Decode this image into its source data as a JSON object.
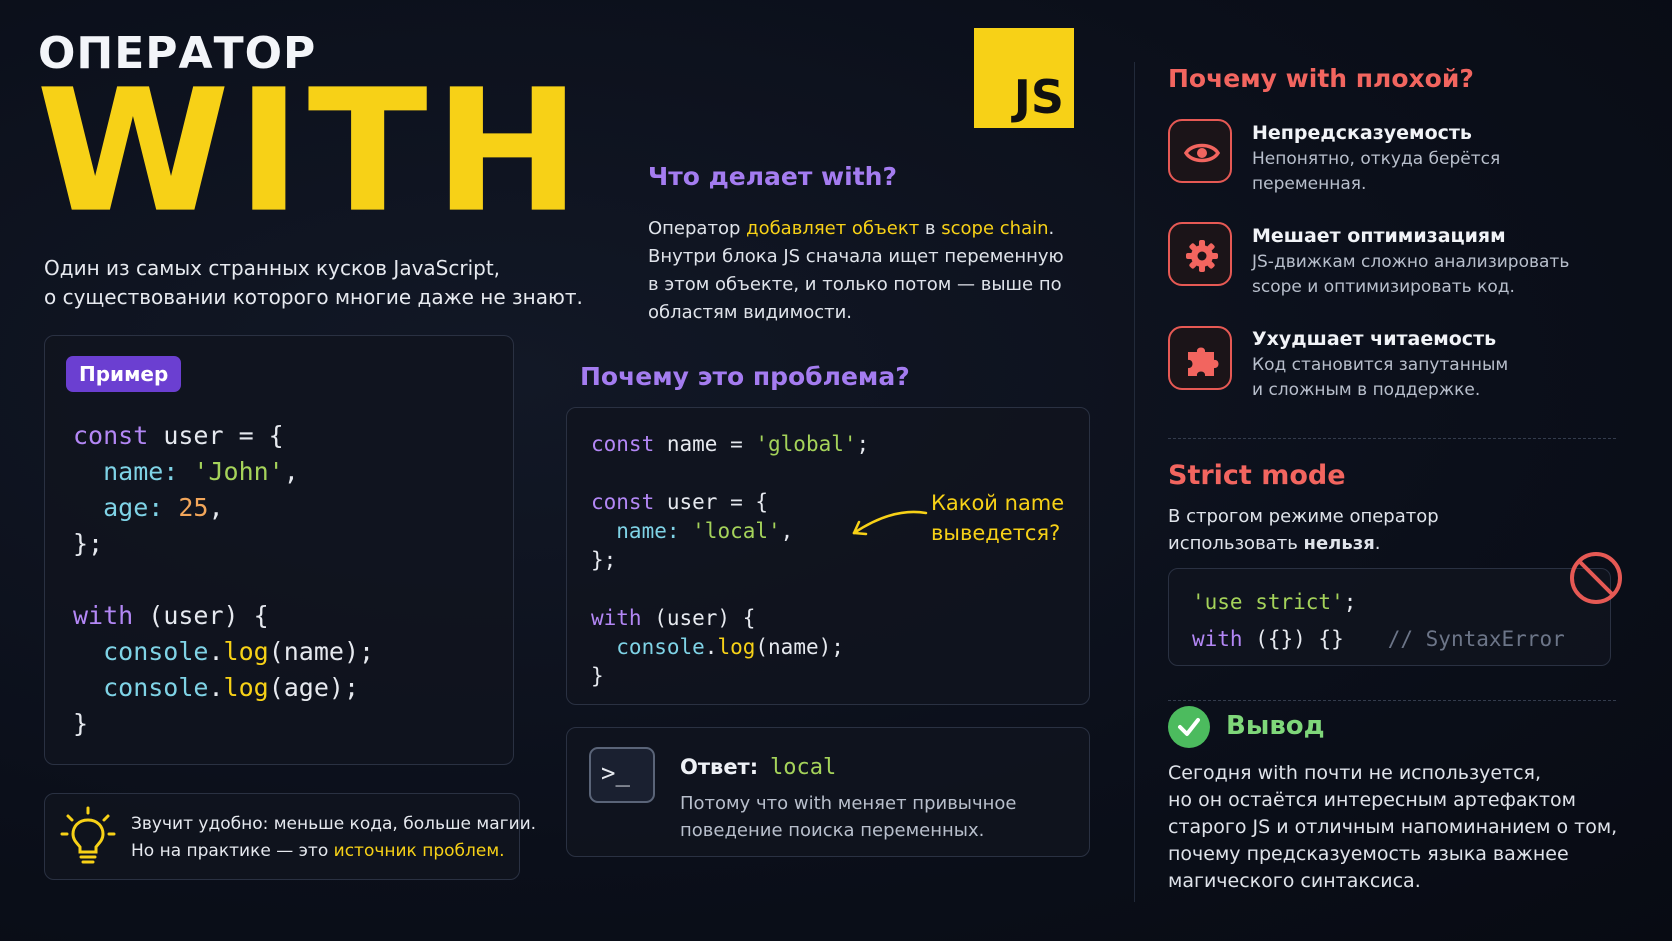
{
  "header": {
    "kicker": "ОПЕРАТОР",
    "title": "WITH",
    "subtitle_line1": "Один из самых странных кусков JavaScript,",
    "subtitle_line2": "о существовании которого многие даже не знают."
  },
  "logo": {
    "text": "JS",
    "color": "#f7d117"
  },
  "example": {
    "badge": "Пример",
    "code": {
      "l1_kw": "const",
      "l1_rest": " user = {",
      "l2_prop": "  name:",
      "l2_str": " 'John'",
      "l2_end": ",",
      "l3_prop": "  age:",
      "l3_num": " 25",
      "l3_end": ",",
      "l4": "};",
      "l5": "",
      "l6_kw": "with",
      "l6_rest": " (user) {",
      "l7_obj": "  console",
      "l7_dot": ".",
      "l7_fn": "log",
      "l7_rest": "(name);",
      "l8_obj": "  console",
      "l8_dot": ".",
      "l8_fn": "log",
      "l8_rest": "(age);",
      "l9": "}"
    }
  },
  "tip": {
    "line1": "Звучит удобно: меньше кода, больше магии.",
    "line2_prefix": "Но на практике — это ",
    "line2_highlight": "источник проблем."
  },
  "what": {
    "heading": "Что делает with?",
    "p_prefix": "Оператор ",
    "p_hl1": "добавляет объект",
    "p_mid": " в ",
    "p_hl2": "scope chain",
    "p_suffix": ". Внутри блока JS сначала ищет переменную в этом объекте, и только потом — выше по областям видимости."
  },
  "problem": {
    "heading": "Почему это проблема?",
    "code": {
      "l1_kw": "const",
      "l1_mid": " name = ",
      "l1_str": "'global'",
      "l1_end": ";",
      "l3_kw": "const",
      "l3_rest": " user = {",
      "l4_prop": "  name:",
      "l4_str": " 'local'",
      "l4_end": ",",
      "l5": "};",
      "l7_kw": "with",
      "l7_rest": " (user) {",
      "l8_obj": "  console",
      "l8_dot": ".",
      "l8_fn": "log",
      "l8_rest": "(name);",
      "l9": "}"
    },
    "annotation_line1": "Какой name",
    "annotation_line2": "выведется?"
  },
  "answer": {
    "label": "Ответ:",
    "value": "local",
    "desc_line1": "Потому что with меняет привычное",
    "desc_line2": "поведение поиска переменных."
  },
  "why_bad": {
    "heading": "Почему with плохой?",
    "items": [
      {
        "icon": "eye-icon",
        "title": "Непредсказуемость",
        "desc_line1": "Непонятно, откуда берётся",
        "desc_line2": "переменная."
      },
      {
        "icon": "gear-icon",
        "title": "Мешает оптимизациям",
        "desc_line1": "JS-движкам сложно анализировать",
        "desc_line2": "scope и оптимизировать код."
      },
      {
        "icon": "puzzle-icon",
        "title": "Ухудшает читаемость",
        "desc_line1": "Код становится запутанным",
        "desc_line2": "и сложным в поддержке."
      }
    ]
  },
  "strict": {
    "heading": "Strict mode",
    "p_line1": "В строгом режиме оператор",
    "p_line2_prefix": "использовать ",
    "p_line2_bold": "нельзя",
    "p_line2_end": ".",
    "code": {
      "l1_str": "'use strict'",
      "l1_end": ";",
      "l2_kw": "with",
      "l2_rest": " ({}) {}",
      "l2_comment": "// SyntaxError"
    }
  },
  "conclusion": {
    "heading": "Вывод",
    "lines": [
      "Сегодня with почти не используется,",
      "но он остаётся интересным артефактом",
      "старого JS и отличным напоминанием о том,",
      "почему предсказуемость языка важнее",
      "магического синтаксиса."
    ]
  },
  "colors": {
    "accent_yellow": "#f7d117",
    "accent_purple": "#a47cf0",
    "accent_red": "#f2655f",
    "accent_green": "#7fd77a",
    "background": "#0b0f1a"
  }
}
